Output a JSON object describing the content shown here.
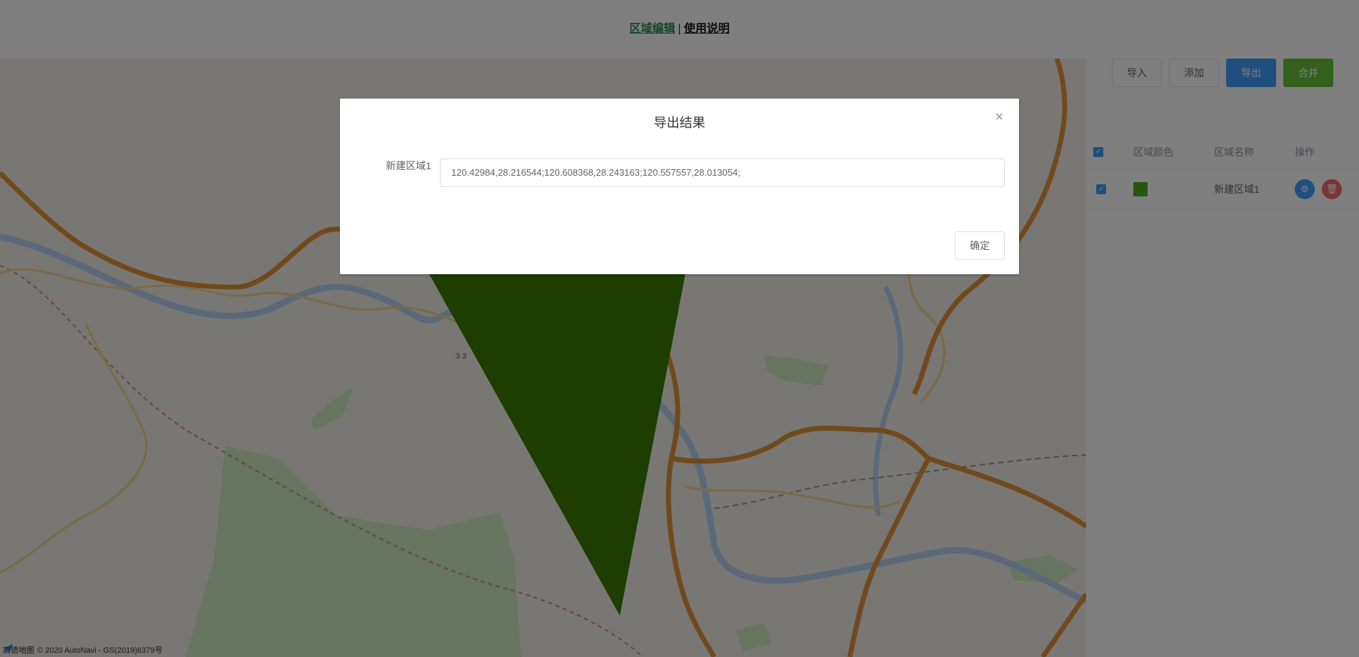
{
  "header": {
    "nav_active": "区域编辑",
    "separator": "|",
    "nav_link": "使用说明"
  },
  "map": {
    "credit_logo_text": "高德地图",
    "credit_text": "© 2020 AutoNavi - GS(2019)6379号",
    "road_label": "3 3",
    "polygon_color": "#3a7d00"
  },
  "toolbar": {
    "import_label": "导入",
    "add_label": "添加",
    "export_label": "导出",
    "merge_label": "合并"
  },
  "table": {
    "headers": {
      "color": "区域颜色",
      "name": "区域名称",
      "actions": "操作"
    },
    "rows": [
      {
        "checked": true,
        "color": "#4cae1f",
        "name": "新建区域1"
      }
    ]
  },
  "dialog": {
    "title": "导出结果",
    "close_glyph": "×",
    "field_label": "新建区域1",
    "field_value": "120.42984,28.216544;120.608368,28.243163;120.557557,28.013054;",
    "confirm_label": "确定"
  },
  "colors": {
    "primary": "#409eff",
    "success": "#67c23a",
    "danger": "#f56c6c",
    "nav_active": "#2e8a57"
  }
}
